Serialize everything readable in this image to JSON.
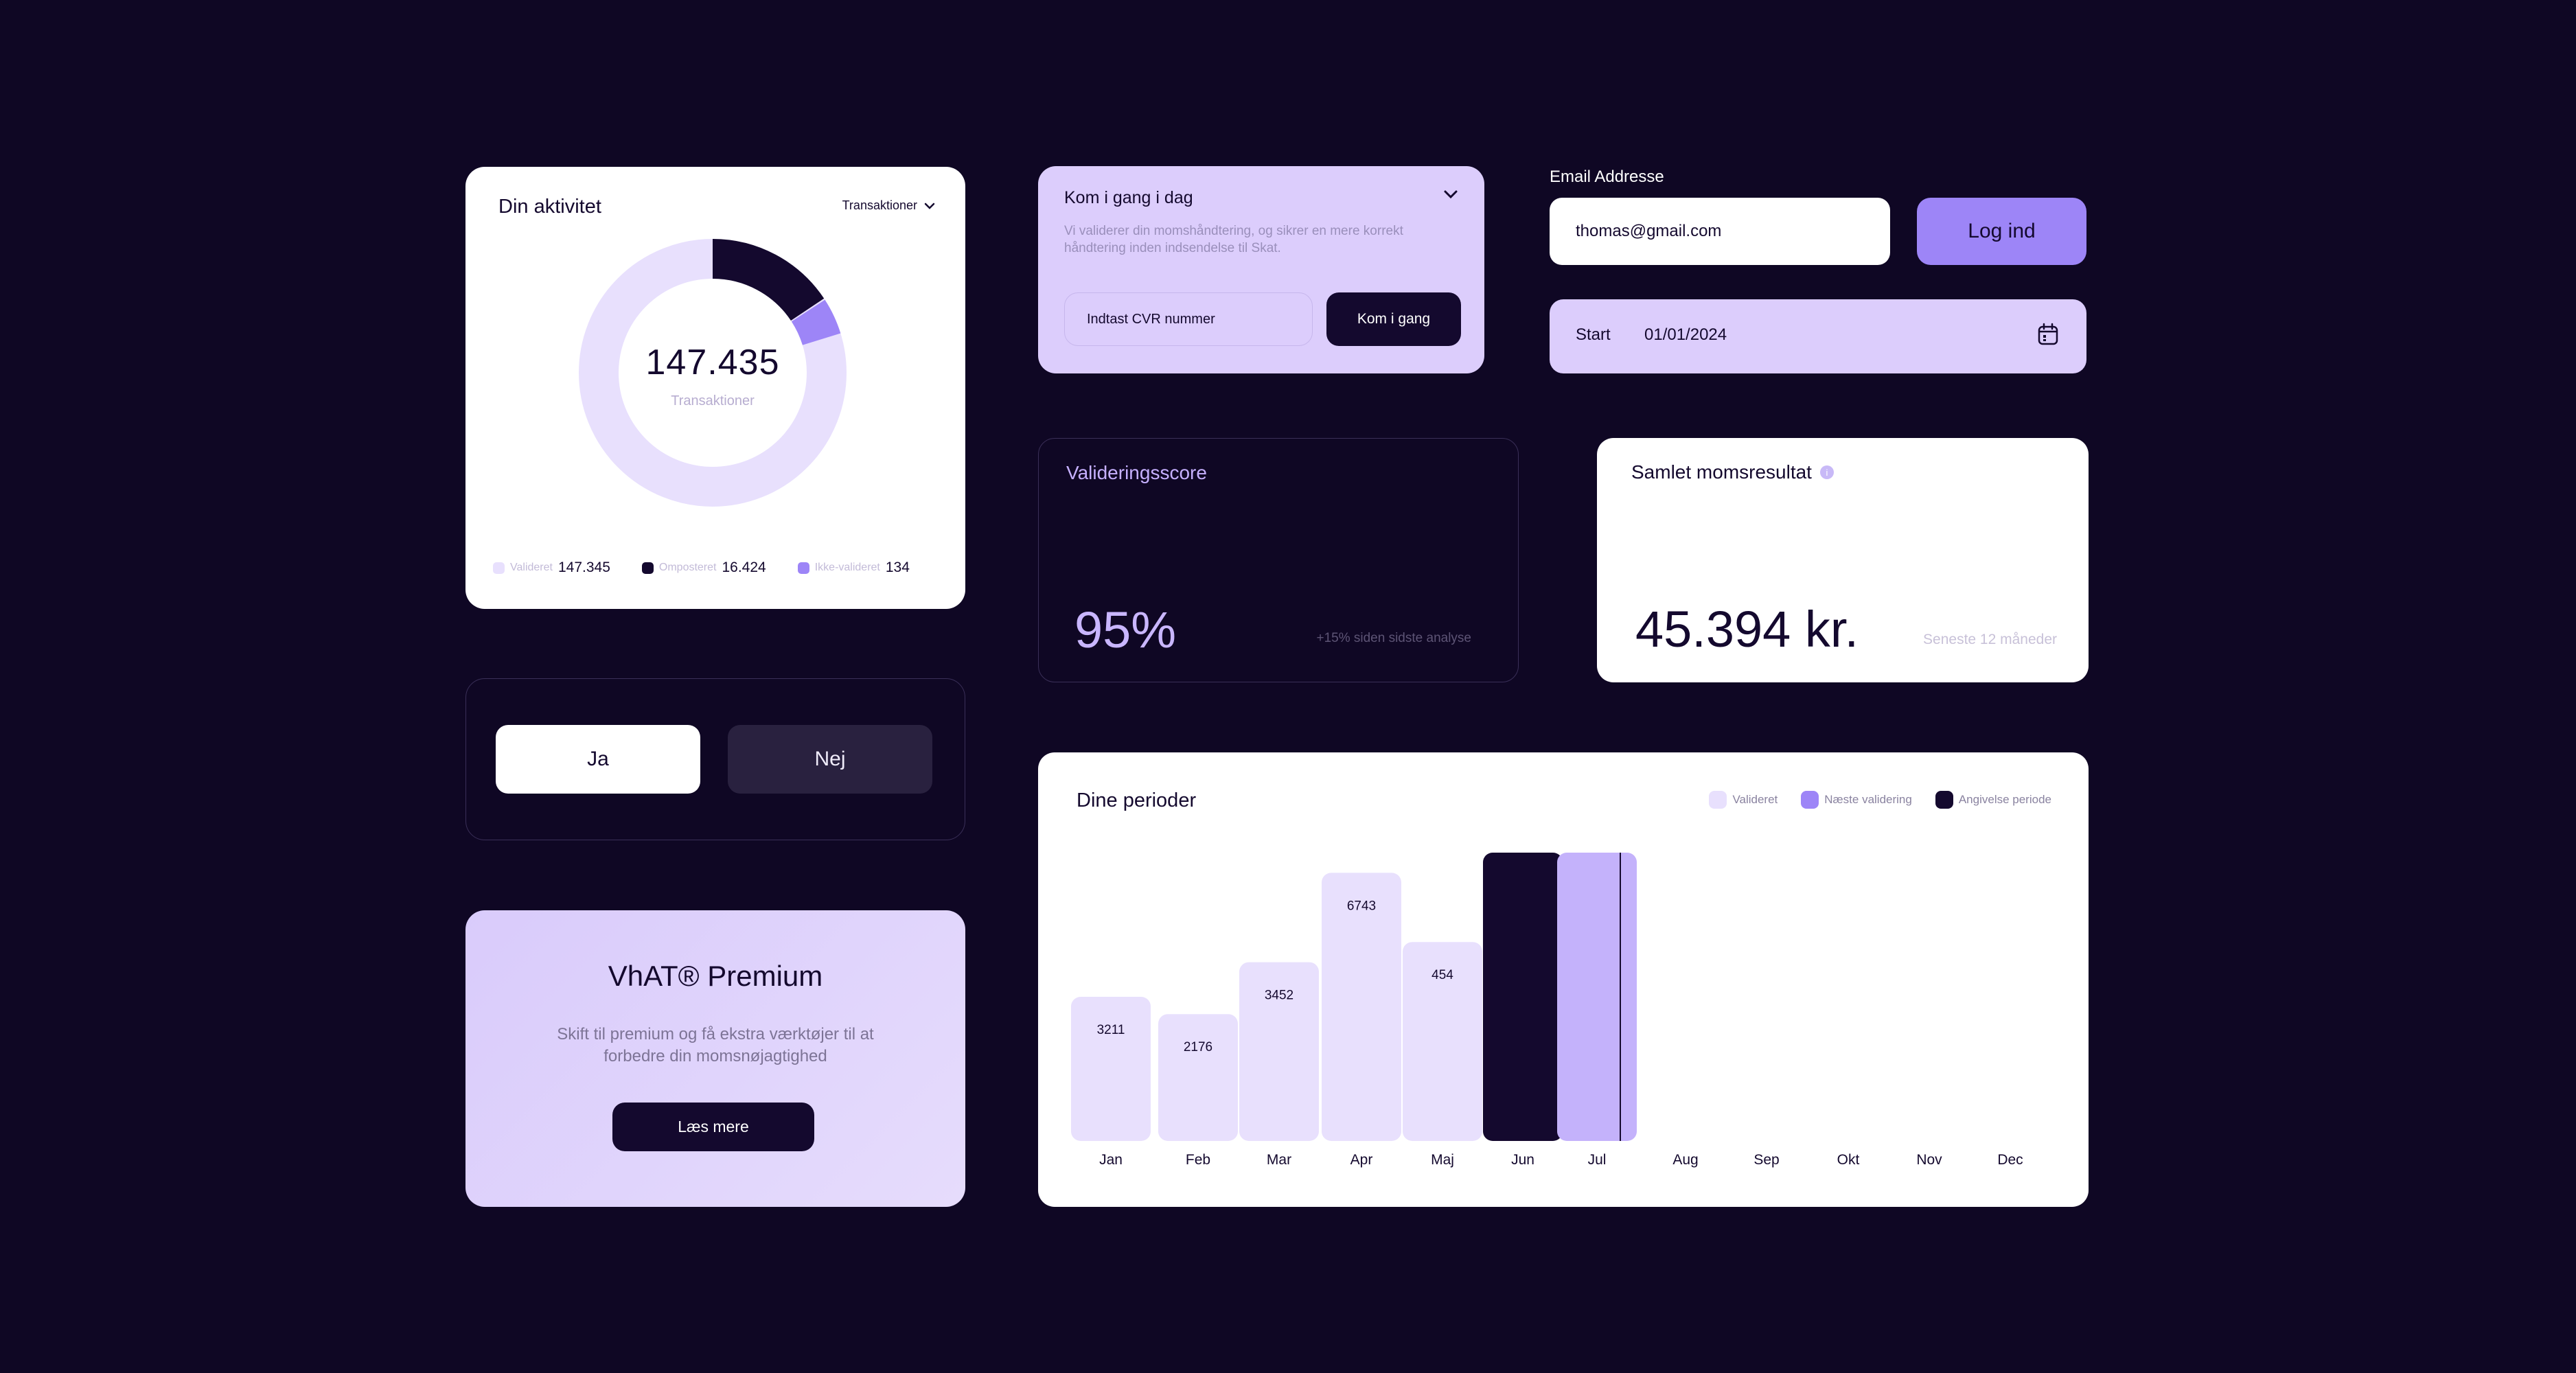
{
  "activity": {
    "title": "Din aktivitet",
    "dropdown_label": "Transaktioner",
    "total": "147.435",
    "total_label": "Transaktioner",
    "legend": [
      {
        "label": "Valideret",
        "value": "147.345",
        "color": "#e8e0fd"
      },
      {
        "label": "Omposteret",
        "value": "16.424",
        "color": "#14092e"
      },
      {
        "label": "Ikke-valideret",
        "value": "134",
        "color": "#9d85f7"
      }
    ]
  },
  "choice": {
    "yes_label": "Ja",
    "no_label": "Nej"
  },
  "premium": {
    "title": "VhAT® Premium",
    "description": "Skift til premium og få ekstra værktøjer til at forbedre din momsnøjagtighed",
    "button_label": "Læs mere"
  },
  "get_started": {
    "title": "Kom i gang i dag",
    "description": "Vi validerer din momshåndtering, og sikrer en mere korrekt håndtering inden indsendelse til Skat.",
    "input_placeholder": "Indtast CVR nummer",
    "button_label": "Kom i gang"
  },
  "login": {
    "email_label": "Email Addresse",
    "email_value": "thomas@gmail.com",
    "button_label": "Log ind"
  },
  "date_field": {
    "label": "Start",
    "value": "01/01/2024"
  },
  "score": {
    "title": "Valideringsscore",
    "value": "95%",
    "note": "+15% siden sidste analyse"
  },
  "vat_result": {
    "title": "Samlet momsresultat",
    "value": "45.394 kr.",
    "note": "Seneste 12 måneder"
  },
  "periods": {
    "title": "Dine perioder",
    "legend": [
      {
        "label": "Valideret",
        "color": "#e8e0fd"
      },
      {
        "label": "Næste validering",
        "color": "#9d85f7"
      },
      {
        "label": "Angivelse periode",
        "color": "#14092e"
      }
    ]
  },
  "chart_data": {
    "type": "bar",
    "title": "Dine perioder",
    "categories": [
      "Jan",
      "Feb",
      "Mar",
      "Apr",
      "Maj",
      "Jun",
      "Jul",
      "Aug",
      "Sep",
      "Okt",
      "Nov",
      "Dec"
    ],
    "series": [
      {
        "name": "Valideret",
        "values": [
          3211,
          2176,
          3452,
          6743,
          454,
          null,
          null,
          null,
          null,
          null,
          null,
          null
        ],
        "labels": [
          "3211",
          "2176",
          "3452",
          "6743",
          "454"
        ]
      },
      {
        "name": "Angivelse periode",
        "values": [
          null,
          null,
          null,
          null,
          null,
          7200,
          null,
          null,
          null,
          null,
          null,
          null
        ]
      },
      {
        "name": "Næste validering",
        "values": [
          null,
          null,
          null,
          null,
          null,
          null,
          7200,
          null,
          null,
          null,
          null,
          null
        ]
      }
    ],
    "colors": {
      "Valideret": "#e8e0fd",
      "Angivelse periode": "#14092e",
      "Næste validering": "#c4b2fb"
    },
    "visual_heights": [
      0.5,
      0.44,
      0.62,
      0.93,
      0.69,
      1.0,
      1.0,
      0,
      0,
      0,
      0,
      0
    ]
  }
}
